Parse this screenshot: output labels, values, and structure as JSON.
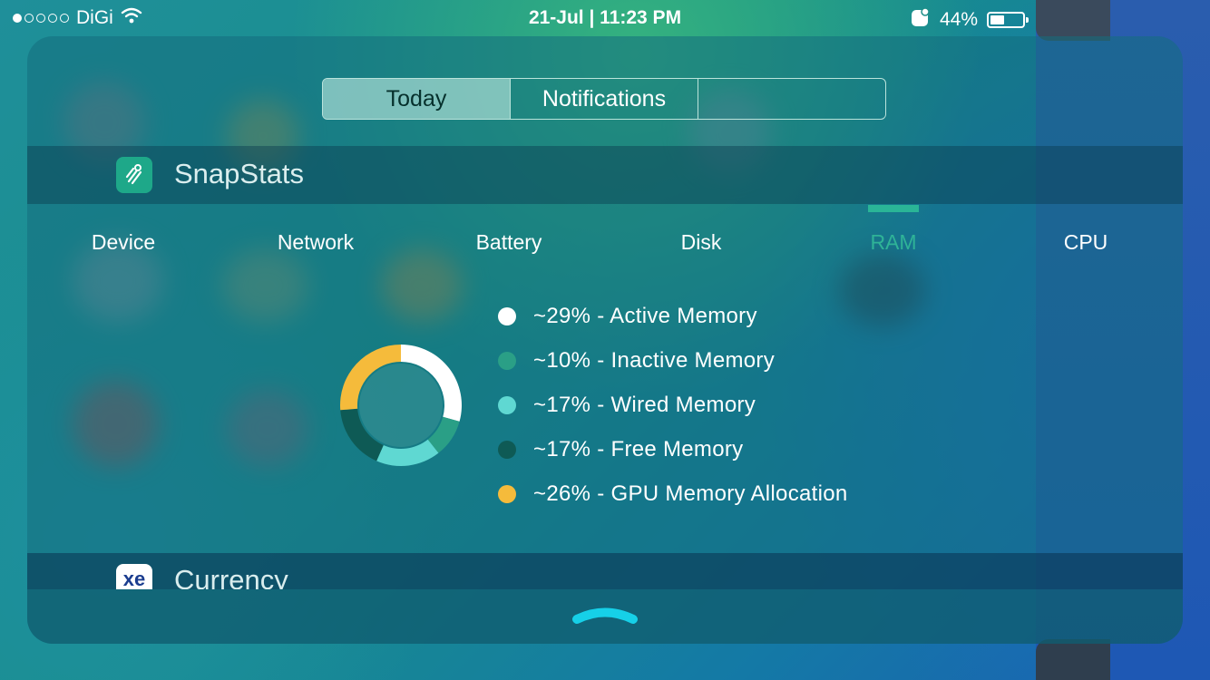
{
  "status_bar": {
    "carrier": "DiGi",
    "datetime": "21-Jul | 11:23 PM",
    "battery_percent": "44%",
    "battery_level": 0.44,
    "signal_dots_filled": 1,
    "signal_dots_total": 5
  },
  "segmented_control": {
    "items": [
      {
        "label": "Today",
        "active": true
      },
      {
        "label": "Notifications",
        "active": false
      },
      {
        "label": "",
        "active": false
      }
    ]
  },
  "widget": {
    "title": "SnapStats",
    "tabs": [
      {
        "label": "Device",
        "active": false
      },
      {
        "label": "Network",
        "active": false
      },
      {
        "label": "Battery",
        "active": false
      },
      {
        "label": "Disk",
        "active": false
      },
      {
        "label": "RAM",
        "active": true
      },
      {
        "label": "CPU",
        "active": false
      }
    ],
    "legend": [
      {
        "text": "~29% - Active Memory",
        "color": "#ffffff"
      },
      {
        "text": "~10% - Inactive Memory",
        "color": "#2a9f86"
      },
      {
        "text": "~17% - Wired Memory",
        "color": "#5fd8d2"
      },
      {
        "text": "~17% - Free Memory",
        "color": "#0e5a55"
      },
      {
        "text": "~26% - GPU Memory Allocation",
        "color": "#f5bb3b"
      }
    ]
  },
  "chart_data": {
    "type": "pie",
    "categories": [
      "Active Memory",
      "Inactive Memory",
      "Wired Memory",
      "Free Memory",
      "GPU Memory Allocation"
    ],
    "values": [
      29,
      10,
      17,
      17,
      26
    ],
    "colors": [
      "#ffffff",
      "#2a9f86",
      "#5fd8d2",
      "#0e5a55",
      "#f5bb3b"
    ]
  },
  "next_widget": {
    "title": "Currency",
    "icon_text": "xe"
  },
  "icons": {
    "wifi": "wifi-icon",
    "lock_rotation": "rotation-lock-icon",
    "app": "snapstats-app-icon",
    "handle": "chevron-up-handle-icon"
  }
}
